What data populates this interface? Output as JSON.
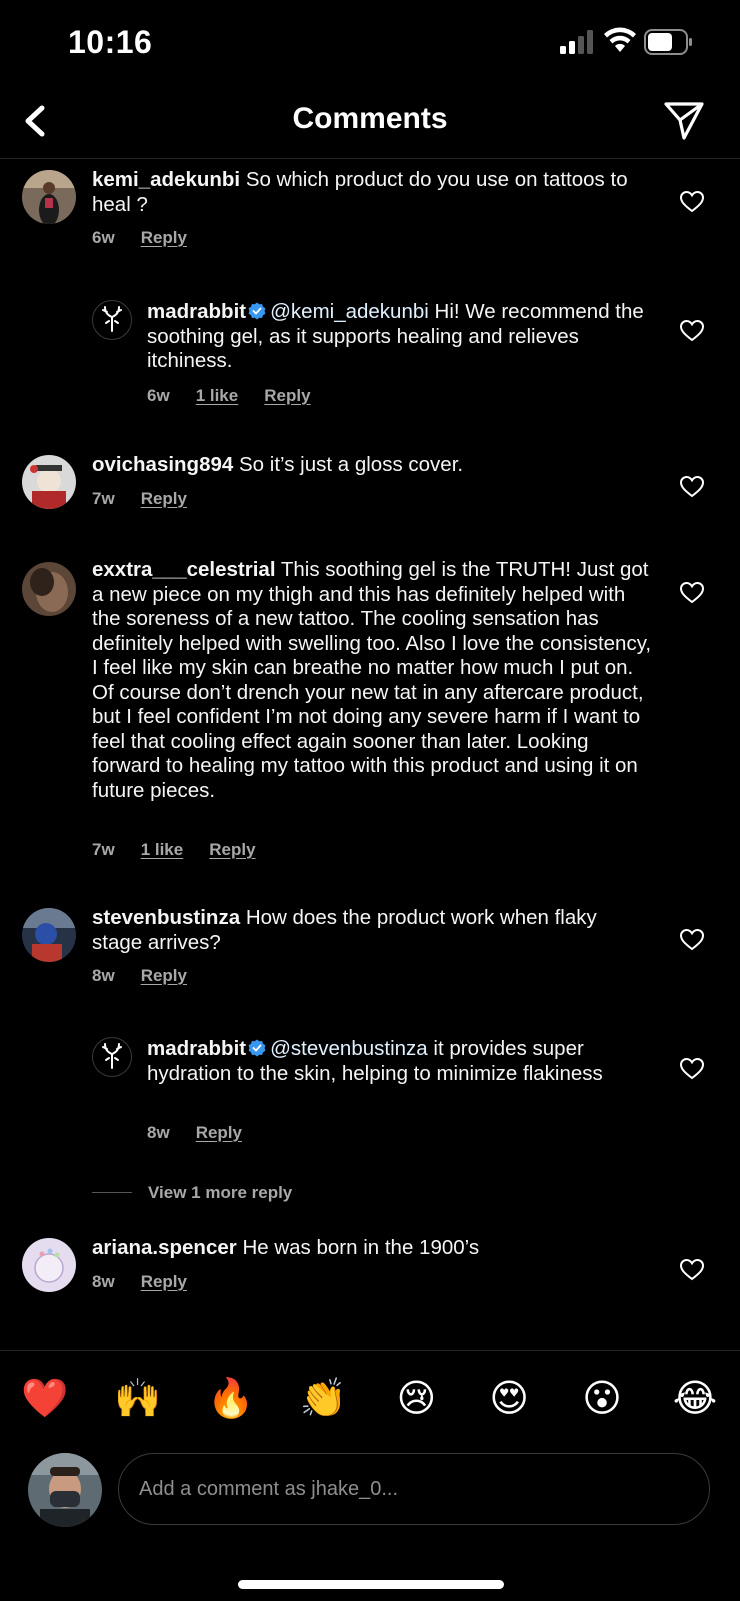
{
  "status": {
    "time": "10:16"
  },
  "header": {
    "title": "Comments"
  },
  "comments": [
    {
      "user": "kemi_adekunbi",
      "text": "So which product do you use on tattoos to heal ?",
      "age": "6w",
      "reply": "Reply"
    },
    {
      "user": "madrabbit",
      "mention": "@kemi_adekunbi",
      "text": "Hi! We recommend the soothing gel, as it supports healing and relieves itchiness.",
      "age": "6w",
      "likes": "1 like",
      "reply": "Reply"
    },
    {
      "user": "ovichasing894",
      "text": "So it’s just a gloss cover.",
      "age": "7w",
      "reply": "Reply"
    },
    {
      "user": "exxtra___celestrial",
      "text": "This soothing gel is the TRUTH! Just got a  new piece on my thigh and this has definitely helped with the soreness of a new tattoo. The cooling sensation has definitely helped with swelling too. Also I love the consistency, I feel like my skin can breathe no matter how much I put on. Of course don’t drench your new tat in any aftercare product, but I feel confident I’m not doing any severe harm if I want to feel that cooling effect again sooner than later. Looking forward to healing my tattoo with this product and using it on future pieces.",
      "age": "7w",
      "likes": "1 like",
      "reply": "Reply"
    },
    {
      "user": "stevenbustinza",
      "text": "How does the product work when flaky stage arrives?",
      "age": "8w",
      "reply": "Reply"
    },
    {
      "user": "madrabbit",
      "mention": "@stevenbustinza",
      "text": "it provides super hydration to the skin, helping to minimize flakiness",
      "age": "8w",
      "reply": "Reply"
    },
    {
      "user": "ariana.spencer",
      "text": "He was born in the 1900’s",
      "age": "8w",
      "reply": "Reply"
    }
  ],
  "view_more": "View 1 more reply",
  "reactions": [
    "❤️",
    "🙌",
    "🔥",
    "👏",
    "😢",
    "😍",
    "😮",
    "😂"
  ],
  "composer": {
    "placeholder": "Add a comment as jhake_0..."
  },
  "icons": {
    "back": "chevron-left-icon",
    "send": "paper-plane-icon",
    "heart": "heart-outline-icon",
    "verified": "verified-badge-icon"
  },
  "colors": {
    "background": "#000000",
    "verified": "#3897f0",
    "secondary_text": "#a8a8a8"
  }
}
